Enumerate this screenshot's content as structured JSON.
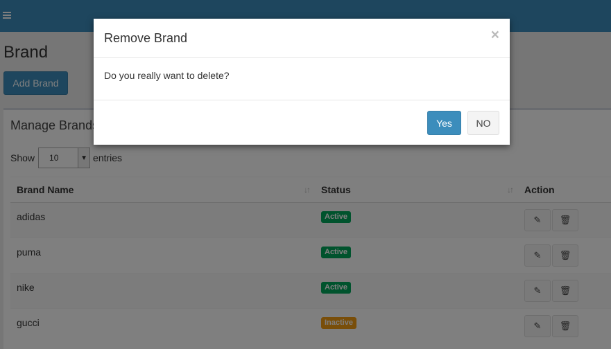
{
  "header": {
    "menu_icon": "hamburger-icon"
  },
  "page": {
    "title": "Brand",
    "add_button": "Add Brand"
  },
  "panel": {
    "title": "Manage Brands",
    "show_label": "Show",
    "entries_label": "entries",
    "page_length": "10"
  },
  "table": {
    "columns": {
      "name": "Brand Name",
      "status": "Status",
      "action": "Action"
    },
    "rows": [
      {
        "name": "adidas",
        "status": "Active",
        "status_color": "#00a65a"
      },
      {
        "name": "puma",
        "status": "Active",
        "status_color": "#00a65a"
      },
      {
        "name": "nike",
        "status": "Active",
        "status_color": "#00a65a"
      },
      {
        "name": "gucci",
        "status": "Inactive",
        "status_color": "#f39c12"
      }
    ]
  },
  "modal": {
    "title": "Remove Brand",
    "close": "×",
    "message": "Do you really want to delete?",
    "yes": "Yes",
    "no": "NO"
  },
  "colors": {
    "primary": "#3c8dbc",
    "success": "#00a65a",
    "warning": "#f39c12"
  }
}
